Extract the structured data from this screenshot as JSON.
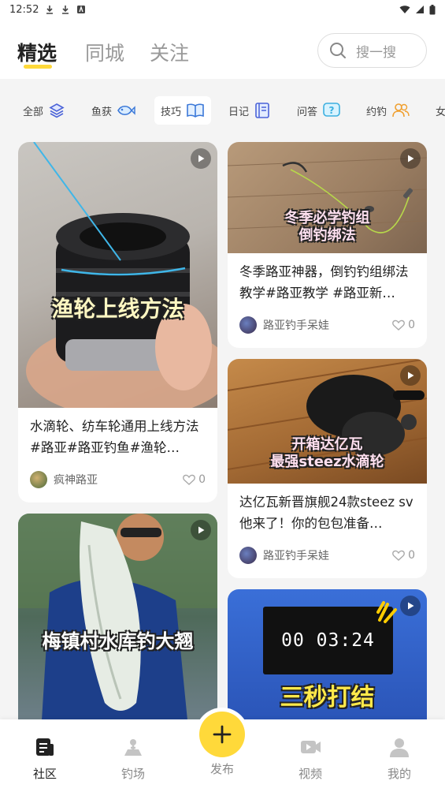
{
  "status_bar": {
    "time": "12:52"
  },
  "top_tabs": [
    {
      "label": "精选",
      "active": true
    },
    {
      "label": "同城",
      "active": false
    },
    {
      "label": "关注",
      "active": false
    }
  ],
  "search": {
    "placeholder": "搜一搜"
  },
  "categories": [
    {
      "label": "全部",
      "icon": "layers-icon"
    },
    {
      "label": "鱼获",
      "icon": "fish-icon"
    },
    {
      "label": "技巧",
      "icon": "book-icon",
      "active": true
    },
    {
      "label": "日记",
      "icon": "notebook-icon"
    },
    {
      "label": "问答",
      "icon": "question-icon"
    },
    {
      "label": "约钓",
      "icon": "users-icon"
    },
    {
      "label": "女"
    }
  ],
  "feed": {
    "left": [
      {
        "overlay": "渔轮上线方法",
        "title": "水滴轮、纺车轮通用上线方法#路亚#路亚钓鱼#渔轮…",
        "author": "疯神路亚",
        "likes": "0"
      },
      {
        "overlay": "梅镇村水库钓大翘"
      }
    ],
    "right": [
      {
        "overlay_line1": "冬季必学钓组",
        "overlay_line2": "倒钓绑法",
        "title": "冬季路亚神器，倒钓钓组绑法教学#路亚教学 #路亚新…",
        "author": "路亚钓手呆娃",
        "likes": "0"
      },
      {
        "overlay_line1": "开箱达亿瓦",
        "overlay_line2": "最强steez水滴轮",
        "title": "达亿瓦新晋旗舰24款steez sv他来了！你的包包准备…",
        "author": "路亚钓手呆娃",
        "likes": "0"
      },
      {
        "timer": "00 03:24",
        "overlay": "三秒打结"
      }
    ]
  },
  "bottom_nav": [
    {
      "label": "社区",
      "active": true
    },
    {
      "label": "钓场"
    },
    {
      "label": "发布"
    },
    {
      "label": "视频"
    },
    {
      "label": "我的"
    }
  ],
  "colors": {
    "accent": "#ffd93a",
    "background": "#f4f4f4"
  }
}
